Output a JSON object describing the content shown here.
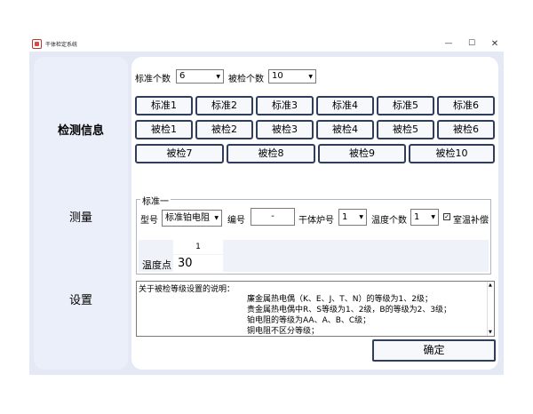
{
  "window": {
    "title": "干体检定系统",
    "minimize_glyph": "—",
    "maximize_glyph": "☐",
    "close_glyph": "✕"
  },
  "sidebar": {
    "items": [
      {
        "label": "检测信息",
        "active": true
      },
      {
        "label": "测量",
        "active": false
      },
      {
        "label": "设置",
        "active": false
      }
    ]
  },
  "counts": {
    "standard_label": "标准个数",
    "standard_value": "6",
    "inspected_label": "被检个数",
    "inspected_value": "10"
  },
  "buttons": {
    "row1": [
      "标准1",
      "标准2",
      "标准3",
      "标准4",
      "标准5",
      "标准6"
    ],
    "row2": [
      "被检1",
      "被检2",
      "被检3",
      "被检4",
      "被检5",
      "被检6"
    ],
    "row3": [
      "被检7",
      "被检8",
      "被检9",
      "被检10"
    ]
  },
  "standard_group": {
    "title": "标准一",
    "model_label": "型号",
    "model_value": "标准铂电阻",
    "serial_label": "编号",
    "serial_value": "-",
    "furnace_label": "干体炉号",
    "furnace_value": "1",
    "temp_count_label": "温度个数",
    "temp_count_value": "1",
    "room_temp_label": "室温补偿",
    "room_temp_checked": true
  },
  "temp_grid": {
    "column_header": "1",
    "row_label": "温度点",
    "value": "30"
  },
  "notes": {
    "title": "关于被检等级设置的说明：",
    "lines": [
      "廉金属热电偶（K、E、J、T、N）的等级为1、2级；",
      "贵金属热电偶中R、S等级为1、2级，B的等级为2、3级；",
      "铂电阻的等级为AA、A、B、C级；",
      "铜电阻不区分等级；"
    ]
  },
  "ok_button": {
    "label": "确定"
  },
  "colors": {
    "frame_bg": "#e4e9f5",
    "sidebar_bg": "#ebeffa",
    "button_border": "#2f3e5c"
  }
}
